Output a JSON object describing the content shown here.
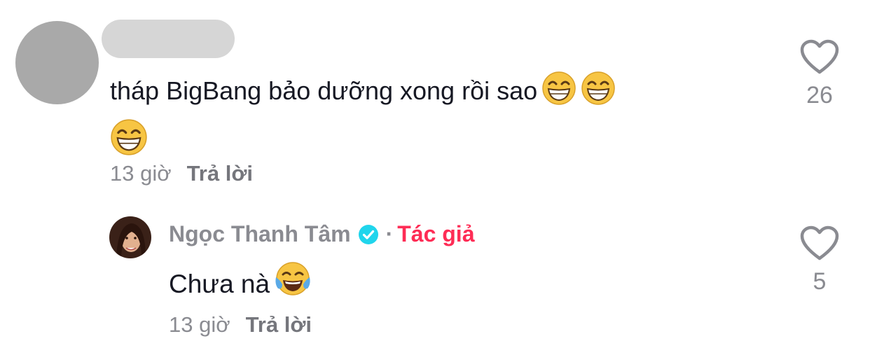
{
  "comment": {
    "text": "tháp BigBang bảo dưỡng xong rồi sao",
    "emoji": [
      "grinning-face-with-smiling-eyes",
      "grinning-face-with-smiling-eyes",
      "grinning-face-with-smiling-eyes"
    ],
    "time": "13 giờ",
    "reply_label": "Trả lời",
    "like_count": "26"
  },
  "reply": {
    "author": "Ngọc Thanh Tâm",
    "separator": "·",
    "author_badge": "Tác giả",
    "text": "Chưa nà",
    "emoji": [
      "face-with-tears-of-joy"
    ],
    "time": "13 giờ",
    "reply_label": "Trả lời",
    "like_count": "5"
  },
  "colors": {
    "author_badge": "#fe2c55",
    "verified": "#20d5ec",
    "muted_text": "#8a8b91",
    "body_text": "#161823"
  }
}
